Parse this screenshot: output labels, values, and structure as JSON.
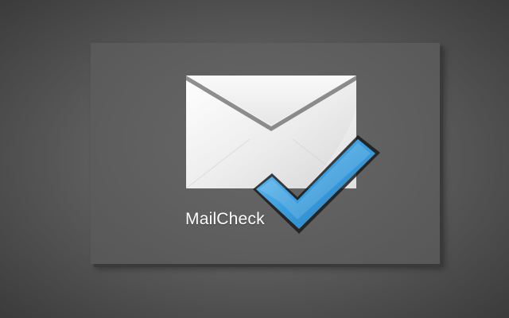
{
  "app": {
    "name": "MailCheck",
    "icons": {
      "envelope": "envelope-icon",
      "check": "checkmark-icon"
    },
    "colors": {
      "background": "#5d5d5d",
      "tile": "#636363",
      "envelope": "#f2f2f2",
      "check": "#3a9bd9",
      "text": "#ffffff"
    }
  }
}
